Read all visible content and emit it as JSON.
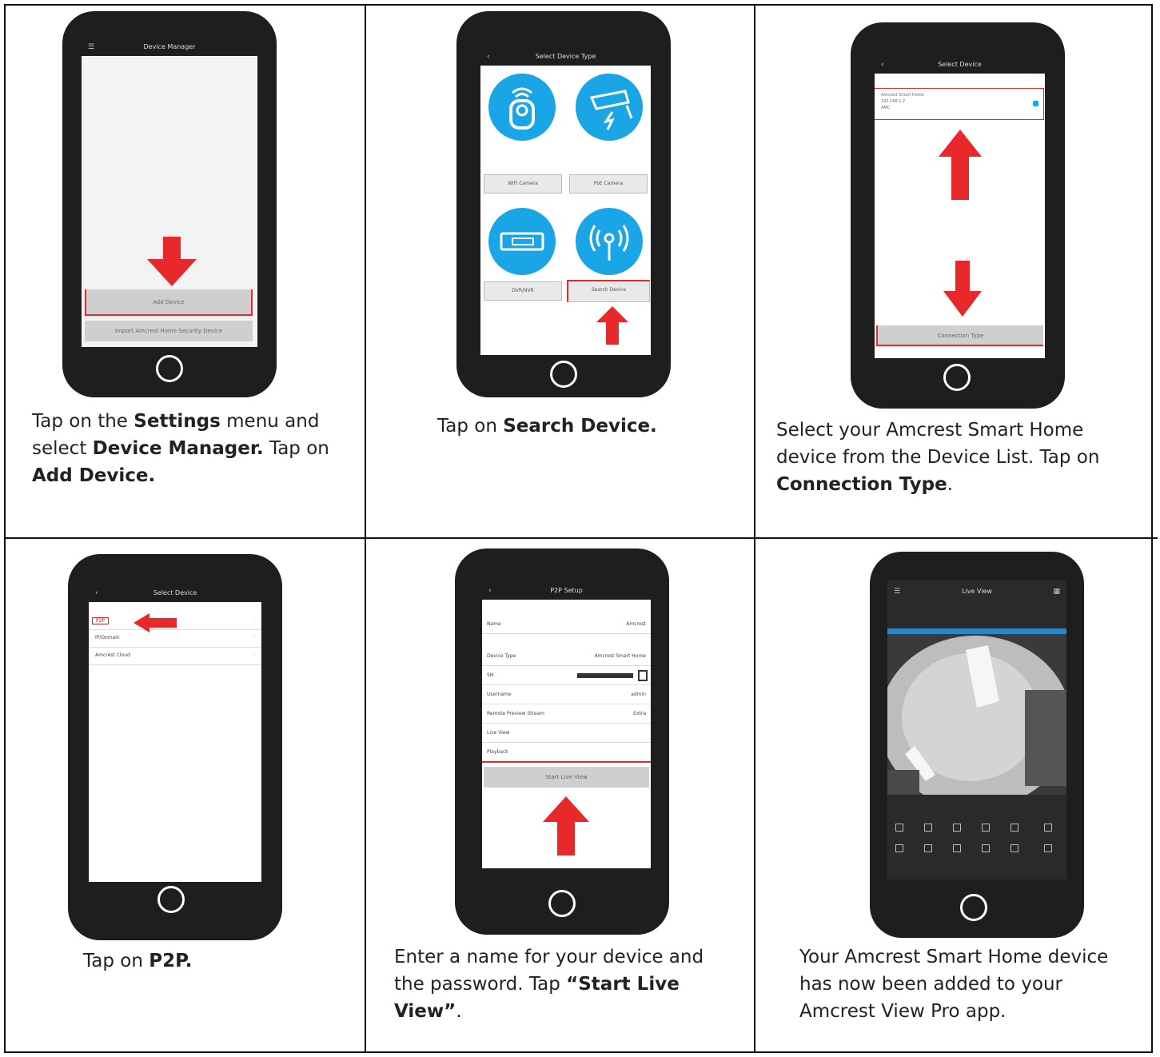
{
  "colors": {
    "accent_red": "#e8292b",
    "phone_body": "#1e1e1e",
    "circle_blue": "#1aa6e6"
  },
  "cells": [
    {
      "screen_title": "Device Manager",
      "buttons": [
        "Add Device",
        "Import Amcrest Home Security Device"
      ],
      "caption": {
        "t1": "Tap on the ",
        "b1": "Settings",
        "t2": " menu and select ",
        "b2": "Device Manager.",
        "t3": " Tap on ",
        "b3": "Add Device."
      }
    },
    {
      "screen_title": "Select Device Type",
      "tiles": [
        "WiFi Camera",
        "PoE Camera",
        "DVR/NVR",
        "Search Device"
      ],
      "caption": {
        "t1": "Tap on ",
        "b1": "Search Device."
      }
    },
    {
      "screen_title": "Select Device",
      "device_lines": [
        "Amcrest Smart Home",
        "192.168.1.2",
        "AMC"
      ],
      "button": "Connection Type",
      "caption": {
        "t1": "Select your Amcrest Smart Home device from the Device List. Tap on ",
        "b1": "Connection Type",
        "t2": "."
      }
    },
    {
      "screen_title": "Select Device",
      "options": [
        "P2P",
        "IP/Domain",
        "Amcrest Cloud"
      ],
      "caption": {
        "t1": "Tap on ",
        "b1": "P2P."
      }
    },
    {
      "screen_title": "P2P Setup",
      "rows": [
        {
          "label": "Name",
          "value": "Amcrest"
        },
        {
          "label": "Device Type",
          "value": "Amcrest Smart Home"
        },
        {
          "label": "SN",
          "value": ""
        },
        {
          "label": "Username",
          "value": "admin"
        },
        {
          "label": "Remote Preview Stream",
          "value": "Extra"
        },
        {
          "label": "Live View",
          "value": ""
        },
        {
          "label": "Playback",
          "value": ""
        }
      ],
      "button": "Start Live View",
      "caption": {
        "t1": "Enter a name for your device and the password. Tap ",
        "b1": "“Start Live View”",
        "t2": "."
      }
    },
    {
      "screen_title": "Live View",
      "caption": {
        "t1": "Your Amcrest Smart Home device has now been added to your Amcrest View Pro app."
      }
    }
  ],
  "icons": [
    "menu-icon",
    "back-icon",
    "home-button-icon",
    "wifi-camera-icon",
    "poe-camera-icon",
    "dvr-icon",
    "antenna-icon",
    "qr-code-icon"
  ]
}
